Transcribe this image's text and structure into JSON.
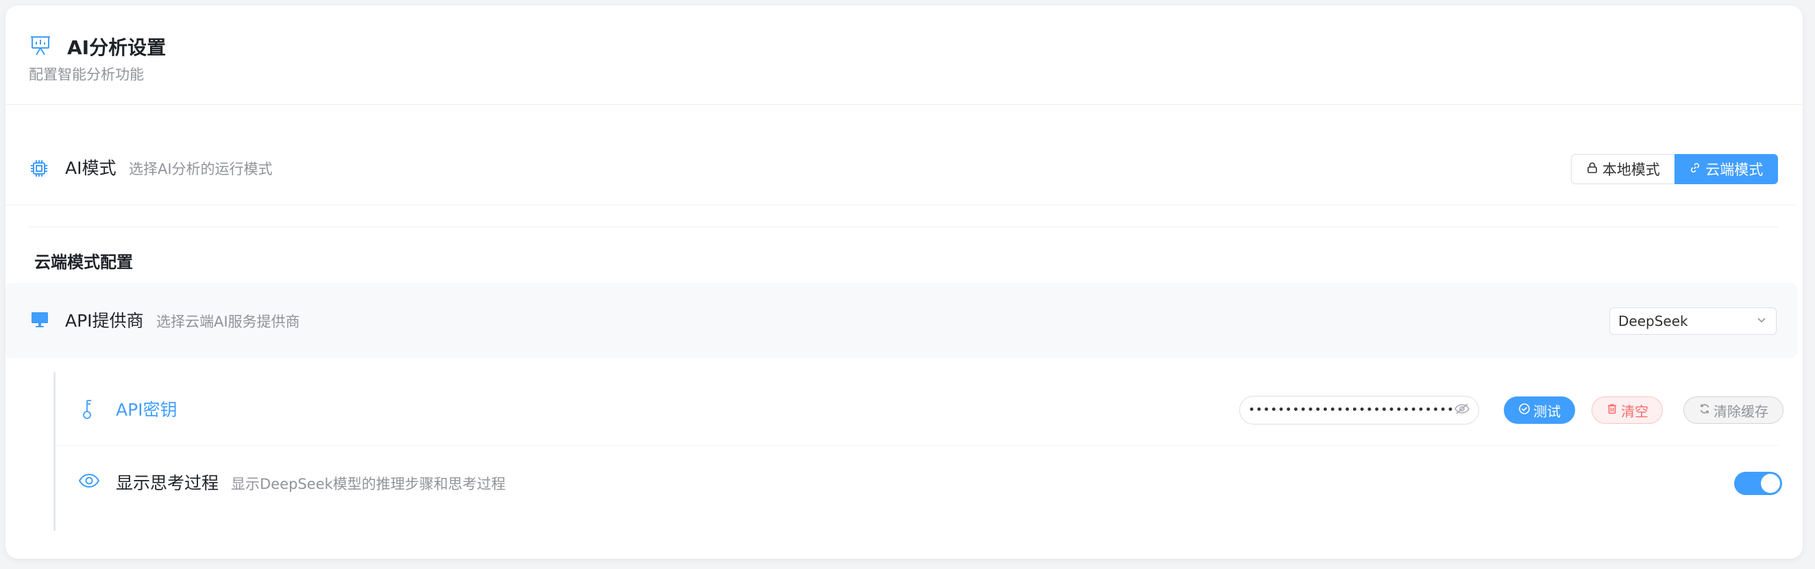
{
  "header": {
    "title": "AI分析设置",
    "subtitle": "配置智能分析功能"
  },
  "ai_mode": {
    "title": "AI模式",
    "description": "选择AI分析的运行模式",
    "options": [
      {
        "label": "本地模式",
        "icon": "lock-icon"
      },
      {
        "label": "云端模式",
        "icon": "link-icon"
      }
    ],
    "selected": "云端模式"
  },
  "cloud_config": {
    "section_title": "云端模式配置",
    "provider": {
      "title": "API提供商",
      "description": "选择云端AI服务提供商",
      "selected": "DeepSeek"
    },
    "api_key": {
      "title": "API密钥",
      "masked_value": "••••••••••••••••••••••••••••••••••••",
      "buttons": {
        "test": "测试",
        "clear": "清空",
        "clear_cache": "清除缓存"
      }
    },
    "show_thinking": {
      "title": "显示思考过程",
      "description": "显示DeepSeek模型的推理步骤和思考过程",
      "enabled": true
    }
  },
  "colors": {
    "accent": "#409eff",
    "danger": "#f56c6c",
    "muted": "#909399"
  }
}
